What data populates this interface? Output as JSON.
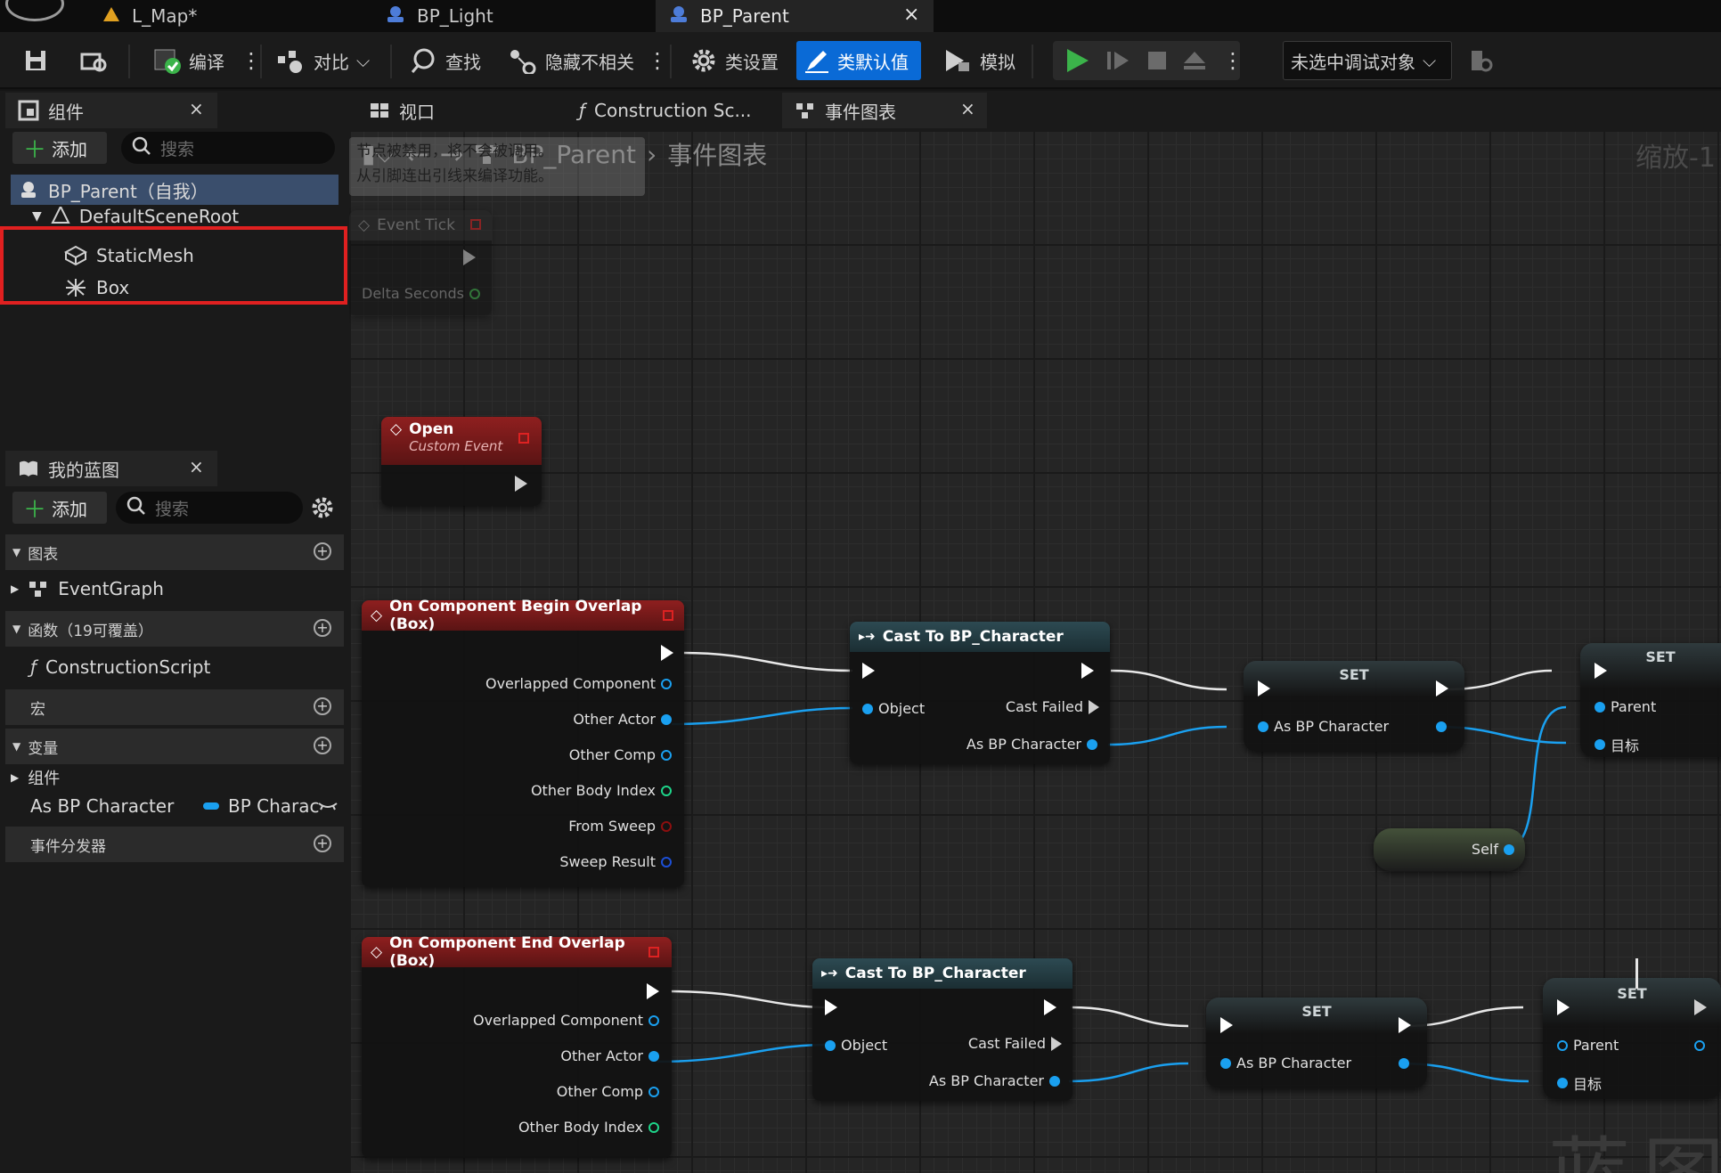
{
  "doc_tabs": [
    {
      "label": "L_Map*"
    },
    {
      "label": "BP_Light"
    },
    {
      "label": "BP_Parent",
      "close": "×"
    }
  ],
  "toolbar": {
    "compile": "编译",
    "diff": "对比",
    "find": "查找",
    "hide_unrelated": "隐藏不相关",
    "class_settings": "类设置",
    "class_defaults": "类默认值",
    "simulate": "模拟",
    "debug_target": "未选中调试对象"
  },
  "components_panel": {
    "title": "组件",
    "close": "×",
    "add": "添加",
    "search_placeholder": "搜索",
    "root": "BP_Parent（自我）",
    "scene_root": "DefaultSceneRoot",
    "items": [
      "StaticMesh",
      "Box"
    ]
  },
  "editor_tabs": [
    {
      "label": "视口"
    },
    {
      "label": "Construction Sc..."
    },
    {
      "label": "事件图表",
      "close": "×"
    }
  ],
  "my_blueprint": {
    "title": "我的蓝图",
    "close": "×",
    "add": "添加",
    "search_placeholder": "搜索",
    "sections": {
      "graphs": "图表",
      "event_graph": "EventGraph",
      "functions": "函数（19可覆盖）",
      "construction_script": "ConstructionScript",
      "macros": "宏",
      "variables": "变量",
      "components": "组件",
      "var_name": "As BP Character",
      "var_type": "BP Charac",
      "dispatchers": "事件分发器"
    }
  },
  "graph": {
    "breadcrumb_class": "BP_Parent",
    "breadcrumb_graph": "事件图表",
    "zoom": "缩放-1",
    "watermark": "蓝图",
    "warning_line1": "节点被禁用，将不会被调用。",
    "warning_line2": "从引脚连出引线来编译功能。",
    "event_tick": {
      "title": "Event Tick",
      "pin": "Delta Seconds"
    },
    "open_event": {
      "title": "Open",
      "subtitle": "Custom Event"
    },
    "begin_overlap": {
      "title": "On Component Begin Overlap (Box)",
      "pins": [
        "Overlapped Component",
        "Other Actor",
        "Other Comp",
        "Other Body Index",
        "From Sweep",
        "Sweep Result"
      ]
    },
    "end_overlap": {
      "title": "On Component End Overlap (Box)",
      "pins": [
        "Overlapped Component",
        "Other Actor",
        "Other Comp",
        "Other Body Index"
      ]
    },
    "cast": {
      "title": "Cast To BP_Character",
      "object": "Object",
      "failed": "Cast Failed",
      "result": "As BP Character"
    },
    "set_var": {
      "title": "SET",
      "pin": "As BP Character"
    },
    "set_parent": {
      "title": "SET",
      "parent": "Parent",
      "target": "目标"
    },
    "self_node": "Self"
  },
  "colors": {
    "accent": "#0a6ad6",
    "highlight_box": "#e02020",
    "object_pin": "#1aa0f0",
    "int_pin": "#1ed58a",
    "bool_pin": "#8c0f0f",
    "struct_pin": "#1c4fd6"
  }
}
